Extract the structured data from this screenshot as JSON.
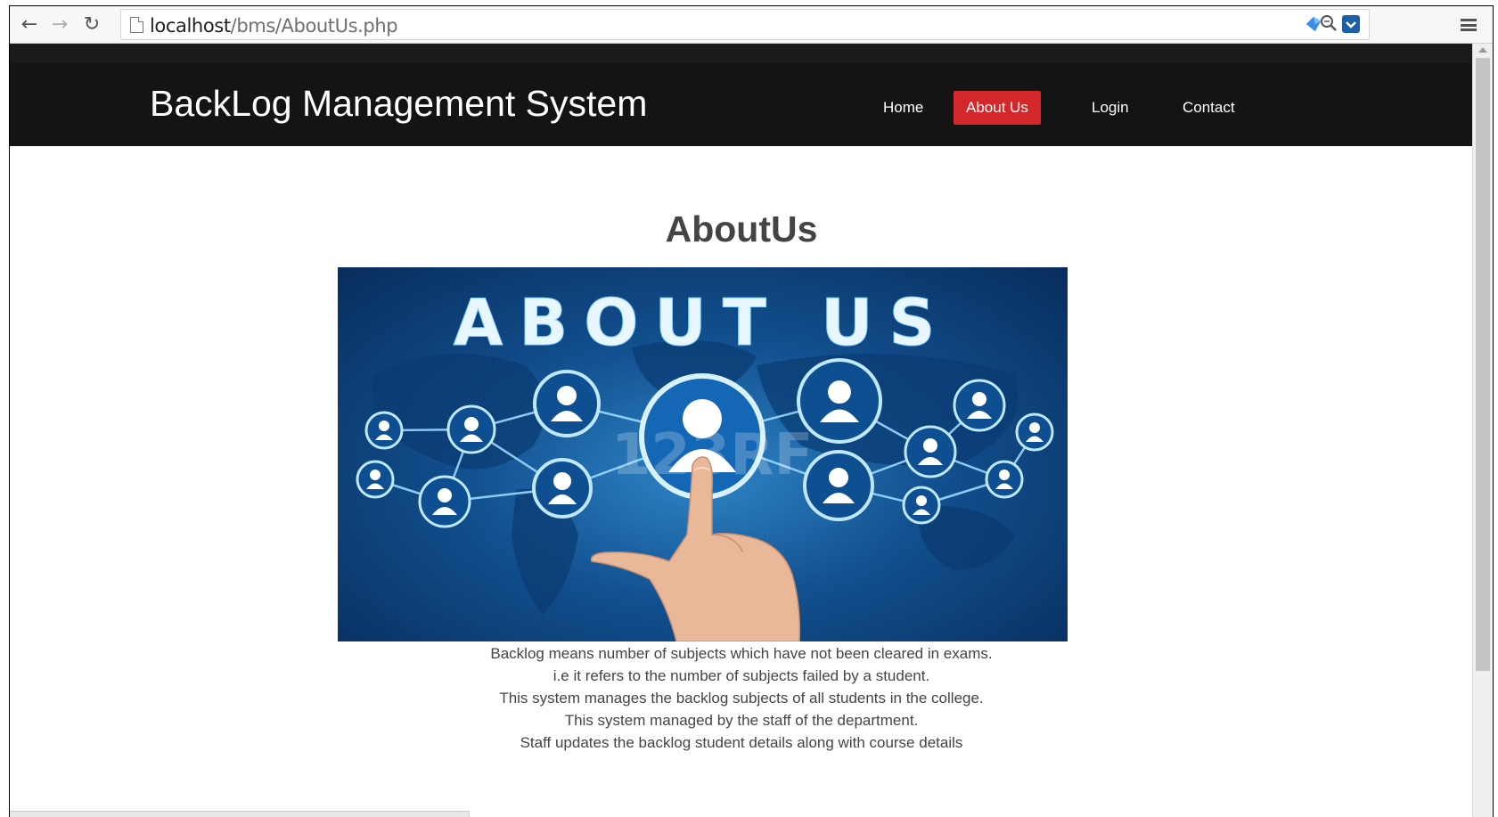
{
  "browser": {
    "url_host": "localhost",
    "url_path": "/bms/AboutUs.php",
    "icons": [
      "back-arrow-icon",
      "forward-arrow-icon",
      "reload-icon",
      "page-icon",
      "zoom-icon",
      "star-icon",
      "extension-icon",
      "pocket-icon",
      "menu-icon"
    ]
  },
  "site": {
    "brand": "BackLog Management System",
    "nav": [
      {
        "label": "Home",
        "active": false
      },
      {
        "label": "About Us",
        "active": true
      },
      {
        "label": "Login",
        "active": false
      },
      {
        "label": "Contact",
        "active": false
      }
    ],
    "heading": "AboutUs",
    "hero_text": "ABOUT US",
    "hero_watermark": "123RF",
    "description": [
      "Backlog means number of subjects which have not been cleared in exams.",
      "i.e it refers to the number of subjects failed by a student.",
      "This system manages the backlog subjects of all students in the college.",
      "This system managed by the staff of the department.",
      "Staff updates the backlog student details along with course details"
    ]
  },
  "colors": {
    "navbar_bg": "#141414",
    "nav_active_bg": "#d2272b",
    "heading_text": "#444444",
    "hero_bg": "#12508f"
  }
}
